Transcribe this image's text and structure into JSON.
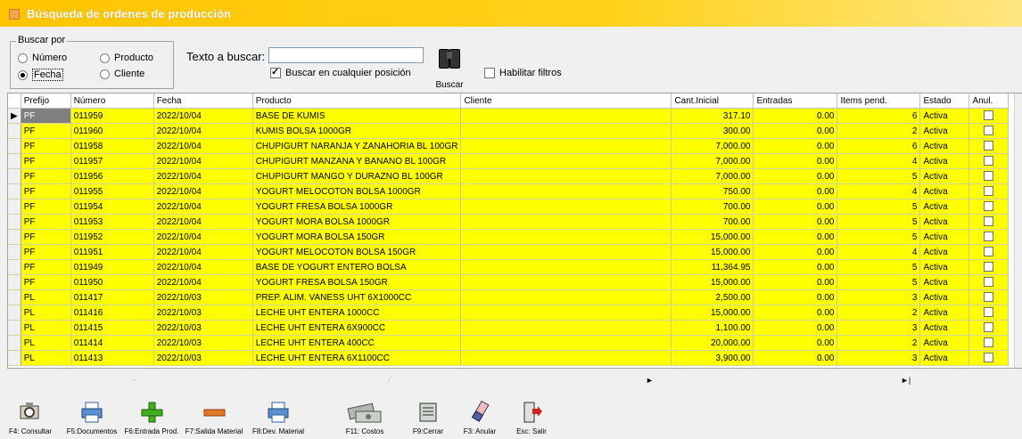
{
  "window": {
    "title": "Búsqueda de ordenes de producción"
  },
  "search": {
    "group_label": "Buscar por",
    "options": {
      "numero": "Número",
      "producto": "Producto",
      "fecha": "Fecha",
      "cliente": "Cliente"
    },
    "selected": "Fecha",
    "text_label": "Texto a buscar:",
    "text_value": "",
    "any_position_label": "Buscar en cualquier posición",
    "any_position_checked": true,
    "search_button": "Buscar",
    "filters_label": "Habilitar filtros",
    "filters_checked": false
  },
  "grid": {
    "columns": [
      "Prefijo",
      "Número",
      "Fecha",
      "Producto",
      "Cliente",
      "Cant.Inicial",
      "Entradas",
      "Items pend.",
      "Estado",
      "Anul."
    ],
    "rows": [
      [
        "PF",
        "011959",
        "2022/10/04",
        "BASE DE KUMIS",
        "",
        "317.10",
        "0.00",
        "6",
        "Activa"
      ],
      [
        "PF",
        "011960",
        "2022/10/04",
        "KUMIS BOLSA 1000GR",
        "",
        "300.00",
        "0.00",
        "2",
        "Activa"
      ],
      [
        "PF",
        "011958",
        "2022/10/04",
        "CHUPIGURT NARANJA Y ZANAHORIA BL 100GR",
        "",
        "7,000.00",
        "0.00",
        "6",
        "Activa"
      ],
      [
        "PF",
        "011957",
        "2022/10/04",
        "CHUPIGURT MANZANA Y BANANO BL 100GR",
        "",
        "7,000.00",
        "0.00",
        "4",
        "Activa"
      ],
      [
        "PF",
        "011956",
        "2022/10/04",
        "CHUPIGURT MANGO Y DURAZNO BL 100GR",
        "",
        "7,000.00",
        "0.00",
        "5",
        "Activa"
      ],
      [
        "PF",
        "011955",
        "2022/10/04",
        "YOGURT MELOCOTON BOLSA 1000GR",
        "",
        "750.00",
        "0.00",
        "4",
        "Activa"
      ],
      [
        "PF",
        "011954",
        "2022/10/04",
        "YOGURT FRESA BOLSA 1000GR",
        "",
        "700.00",
        "0.00",
        "5",
        "Activa"
      ],
      [
        "PF",
        "011953",
        "2022/10/04",
        "YOGURT MORA BOLSA 1000GR",
        "",
        "700.00",
        "0.00",
        "5",
        "Activa"
      ],
      [
        "PF",
        "011952",
        "2022/10/04",
        "YOGURT MORA BOLSA 150GR",
        "",
        "15,000.00",
        "0.00",
        "5",
        "Activa"
      ],
      [
        "PF",
        "011951",
        "2022/10/04",
        "YOGURT MELOCOTON BOLSA 150GR",
        "",
        "15,000.00",
        "0.00",
        "4",
        "Activa"
      ],
      [
        "PF",
        "011949",
        "2022/10/04",
        "BASE DE YOGURT ENTERO BOLSA",
        "",
        "11,364.95",
        "0.00",
        "5",
        "Activa"
      ],
      [
        "PF",
        "011950",
        "2022/10/04",
        "YOGURT FRESA BOLSA 150GR",
        "",
        "15,000.00",
        "0.00",
        "5",
        "Activa"
      ],
      [
        "PL",
        "011417",
        "2022/10/03",
        "PREP. ALIM. VANESS UHT 6X1000CC",
        "",
        "2,500.00",
        "0.00",
        "3",
        "Activa"
      ],
      [
        "PL",
        "011416",
        "2022/10/03",
        "LECHE UHT ENTERA 1000CC",
        "",
        "15,000.00",
        "0.00",
        "2",
        "Activa"
      ],
      [
        "PL",
        "011415",
        "2022/10/03",
        "LECHE UHT ENTERA 6X900CC",
        "",
        "1,100.00",
        "0.00",
        "3",
        "Activa"
      ],
      [
        "PL",
        "011414",
        "2022/10/03",
        "LECHE UHT ENTERA 400CC",
        "",
        "20,000.00",
        "0.00",
        "2",
        "Activa"
      ],
      [
        "PL",
        "011413",
        "2022/10/03",
        "LECHE UHT ENTERA 6X1100CC",
        "",
        "3,900.00",
        "0.00",
        "3",
        "Activa"
      ]
    ],
    "row_color": "#ffff00",
    "selected_row": 0
  },
  "toolbar": {
    "consultar": "F4: Consultar",
    "documentos": "F5:Documentos",
    "entrada": "F6:Entrada Prod.",
    "salida": "F7:Salida Material",
    "devolucion": "F8:Dev. Material",
    "costos": "F11: Costos",
    "cerrar": "F9:Cerrar",
    "anular": "F3: Anular",
    "salir": "Esc: Salir"
  }
}
